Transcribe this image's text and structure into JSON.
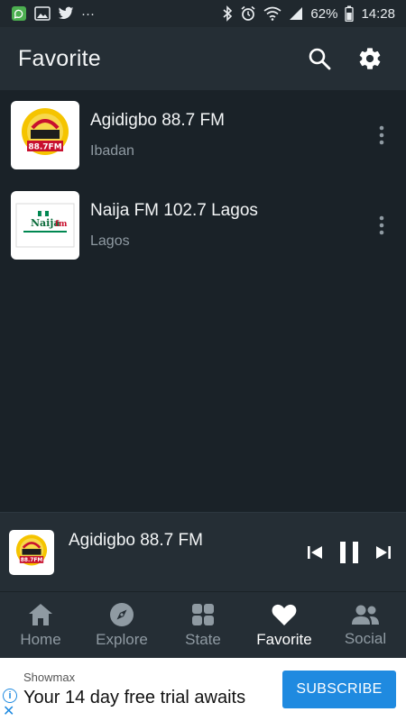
{
  "status_bar": {
    "battery": "62%",
    "time": "14:28",
    "overflow": "···",
    "icons": [
      "whatsapp-icon",
      "image-icon",
      "twitter-icon",
      "bluetooth-icon",
      "alarm-icon",
      "wifi-icon",
      "signal-icon",
      "battery-icon"
    ]
  },
  "app_bar": {
    "title": "Favorite",
    "icons": [
      "search-icon",
      "settings-icon"
    ]
  },
  "stations": [
    {
      "name": "Agidigbo 88.7 FM",
      "location": "Ibadan",
      "logo": "agidigbo-logo"
    },
    {
      "name": "Naija FM 102.7 Lagos",
      "location": "Lagos",
      "logo": "naijafm-logo"
    }
  ],
  "player": {
    "title": "Agidigbo 88.7 FM",
    "controls": [
      "skip-previous-icon",
      "pause-icon",
      "skip-next-icon"
    ]
  },
  "bottom_nav": {
    "items": [
      {
        "label": "Home",
        "icon": "home-icon"
      },
      {
        "label": "Explore",
        "icon": "compass-icon"
      },
      {
        "label": "State",
        "icon": "grid-icon"
      },
      {
        "label": "Favorite",
        "icon": "heart-icon",
        "active": true
      },
      {
        "label": "Social",
        "icon": "people-icon"
      }
    ]
  },
  "ad": {
    "brand": "Showmax",
    "text": "Your 14 day free trial awaits",
    "button": "SUBSCRIBE"
  },
  "colors": {
    "background": "#1a2228",
    "app_bar": "#252e35",
    "accent": "#1f8ae0",
    "muted_text": "#8f9aa2"
  }
}
